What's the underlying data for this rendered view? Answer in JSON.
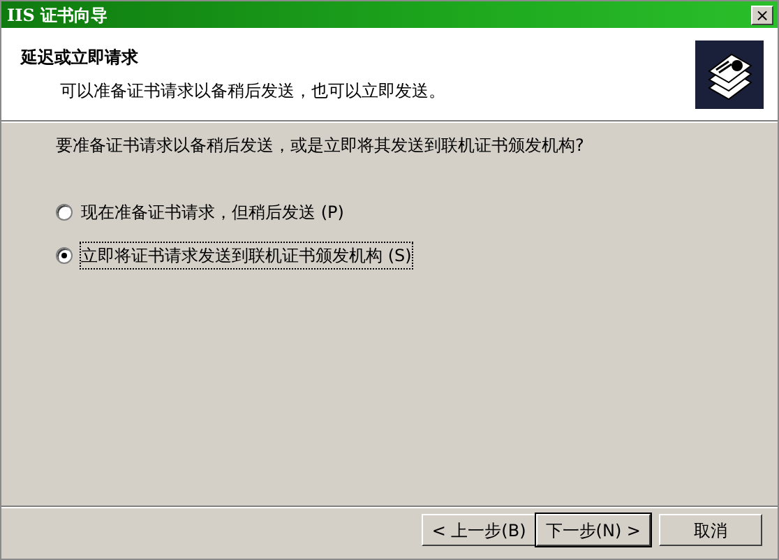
{
  "window": {
    "title": "IIS 证书向导",
    "close": "×"
  },
  "header": {
    "title": "延迟或立即请求",
    "subtitle": "可以准备证书请求以备稍后发送，也可以立即发送。"
  },
  "question": "要准备证书请求以备稍后发送，或是立即将其发送到联机证书颁发机构?",
  "options": [
    {
      "label": "现在准备证书请求，但稍后发送 (P)",
      "selected": false
    },
    {
      "label": "立即将证书请求发送到联机证书颁发机构 (S)",
      "selected": true
    }
  ],
  "buttons": [
    {
      "label": "< 上一步(B)",
      "default": false
    },
    {
      "label": "下一步(N) >",
      "default": true
    },
    {
      "label": "取消",
      "default": false
    }
  ]
}
